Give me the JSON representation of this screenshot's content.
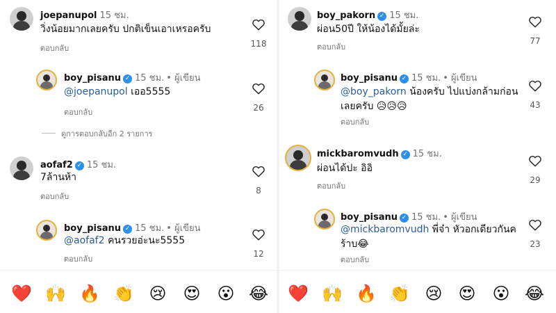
{
  "left_panel": {
    "comments": [
      {
        "username": "joepanupol",
        "time": "15 ชม.",
        "text": "วิ่งน้อยมากเลยครับ ปกติเข็นเอาเหรอครับ",
        "reply_label": "ตอบกลับ",
        "likes": "118"
      },
      {
        "username": "boy_pisanu",
        "verified": "✓",
        "time": "15 ชม.",
        "author_label": "• ผู้เขียน",
        "mention": "@joepanupol",
        "text": " เออ5555",
        "reply_label": "ตอบกลับ",
        "likes": "26"
      },
      {
        "username": "aofaf2",
        "verified": "✓",
        "time": "15 ชม.",
        "text": "7ล้านห้า",
        "reply_label": "ตอบกลับ",
        "likes": "8"
      },
      {
        "username": "boy_pisanu",
        "verified": "✓",
        "time": "15 ชม.",
        "author_label": "• ผู้เขียน",
        "mention": "@aofaf2",
        "text": " คนรวยอ่ะนะ5555",
        "reply_label": "ตอบกลับ",
        "likes": "12"
      }
    ],
    "view_more": "ดูการตอบกลับอีก 2 รายการ"
  },
  "right_panel": {
    "comments": [
      {
        "username": "boy_pakorn",
        "verified": "✓",
        "time": "15 ชม.",
        "text": "ผ่อน50ปี ให้น้องได้มั้ยล่ะ",
        "reply_label": "ตอบกลับ",
        "likes": "77"
      },
      {
        "username": "boy_pisanu",
        "verified": "✓",
        "time": "15 ชม.",
        "author_label": "• ผู้เขียน",
        "mention": "@boy_pakorn",
        "text": " น้องครับ ไปแบ่งกล้ามก่อนเลยครับ 😥😥😥",
        "reply_label": "ตอบกลับ",
        "likes": "43"
      },
      {
        "username": "mickbaromvudh",
        "verified": "✓",
        "time": "15 ชม.",
        "text": "ผ่อนได้ปะ อิอิ",
        "reply_label": "ตอบกลับ",
        "likes": "29"
      },
      {
        "username": "boy_pisanu",
        "verified": "✓",
        "time": "15 ชม.",
        "author_label": "• ผู้เขียน",
        "mention": "@mickbaromvudh",
        "text": " พี่จ๋า หัวอกเดียวกันคร้าบ😂",
        "reply_label": "ตอบกลับ",
        "likes": "23"
      }
    ]
  },
  "emoji_bar": [
    "❤️",
    "🙌",
    "🔥",
    "👏",
    "😢",
    "😍",
    "😮",
    "😂"
  ],
  "colors": {
    "mention": "#2b5c9e",
    "verified": "#2d8fe6",
    "muted": "#737373"
  }
}
